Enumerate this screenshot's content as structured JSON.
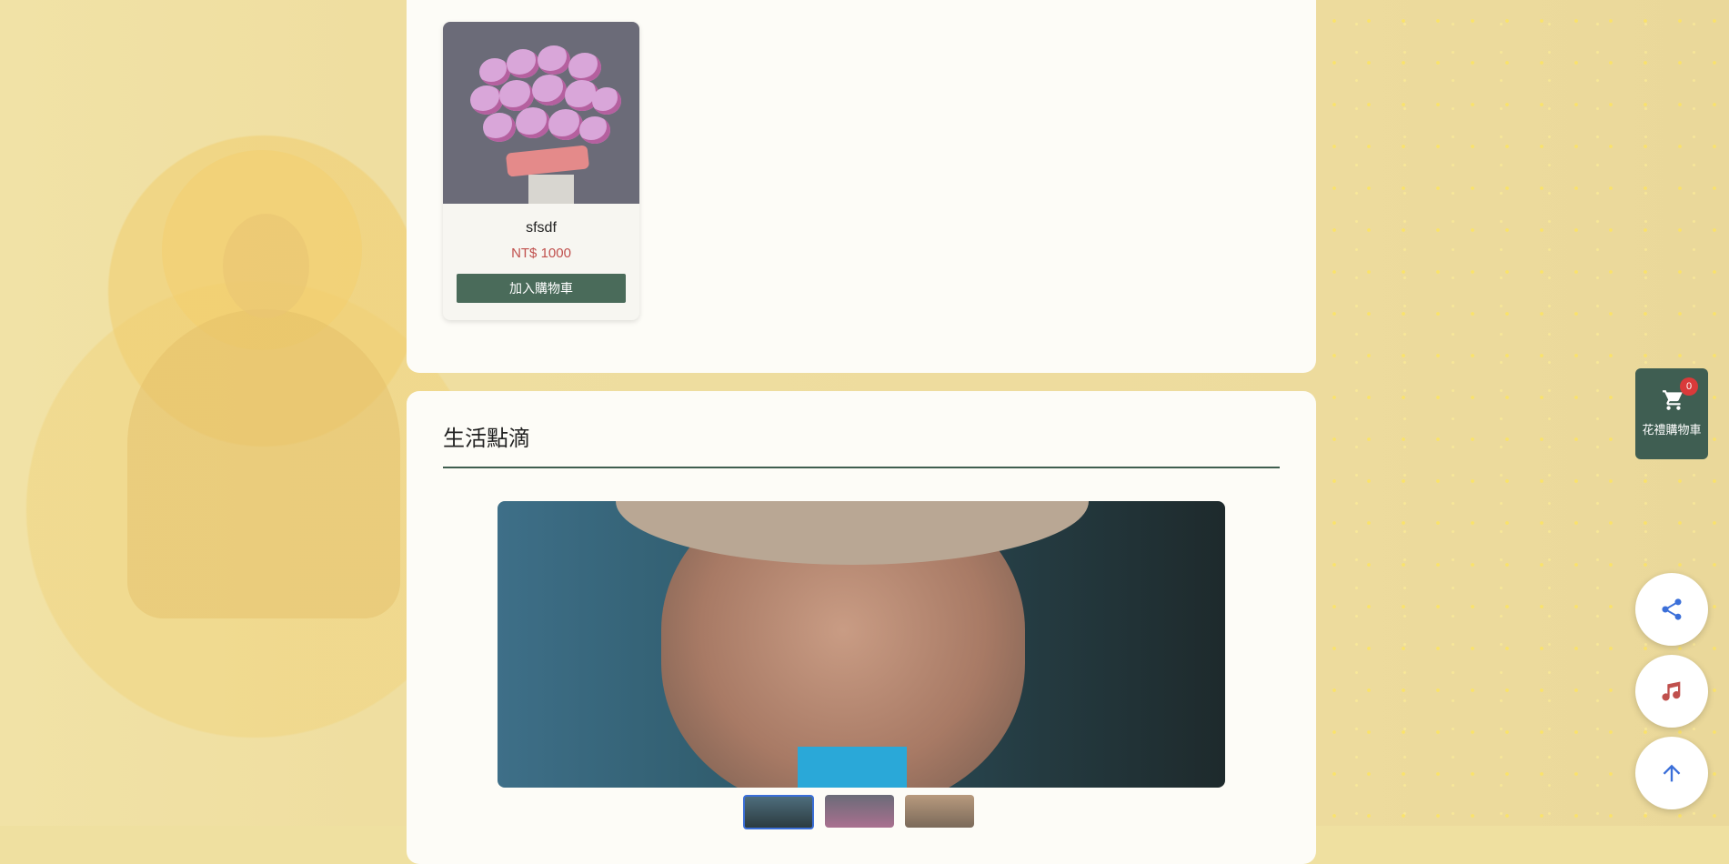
{
  "product": {
    "name": "sfsdf",
    "price": "NT$ 1000",
    "add_to_cart_label": "加入購物車"
  },
  "life_section": {
    "title": "生活點滴",
    "thumbnails": [
      "thumbnail-portrait",
      "thumbnail-orchid",
      "thumbnail-portrait-2"
    ]
  },
  "floating": {
    "cart_label": "花禮購物車",
    "cart_count": "0",
    "share_icon": "share-icon",
    "music_icon": "music-note-icon",
    "top_icon": "arrow-up-icon"
  },
  "colors": {
    "accent_green": "#4a6b5a",
    "price_red": "#c0504d",
    "icon_blue": "#3b6fd9",
    "music_red": "#c0504d"
  }
}
